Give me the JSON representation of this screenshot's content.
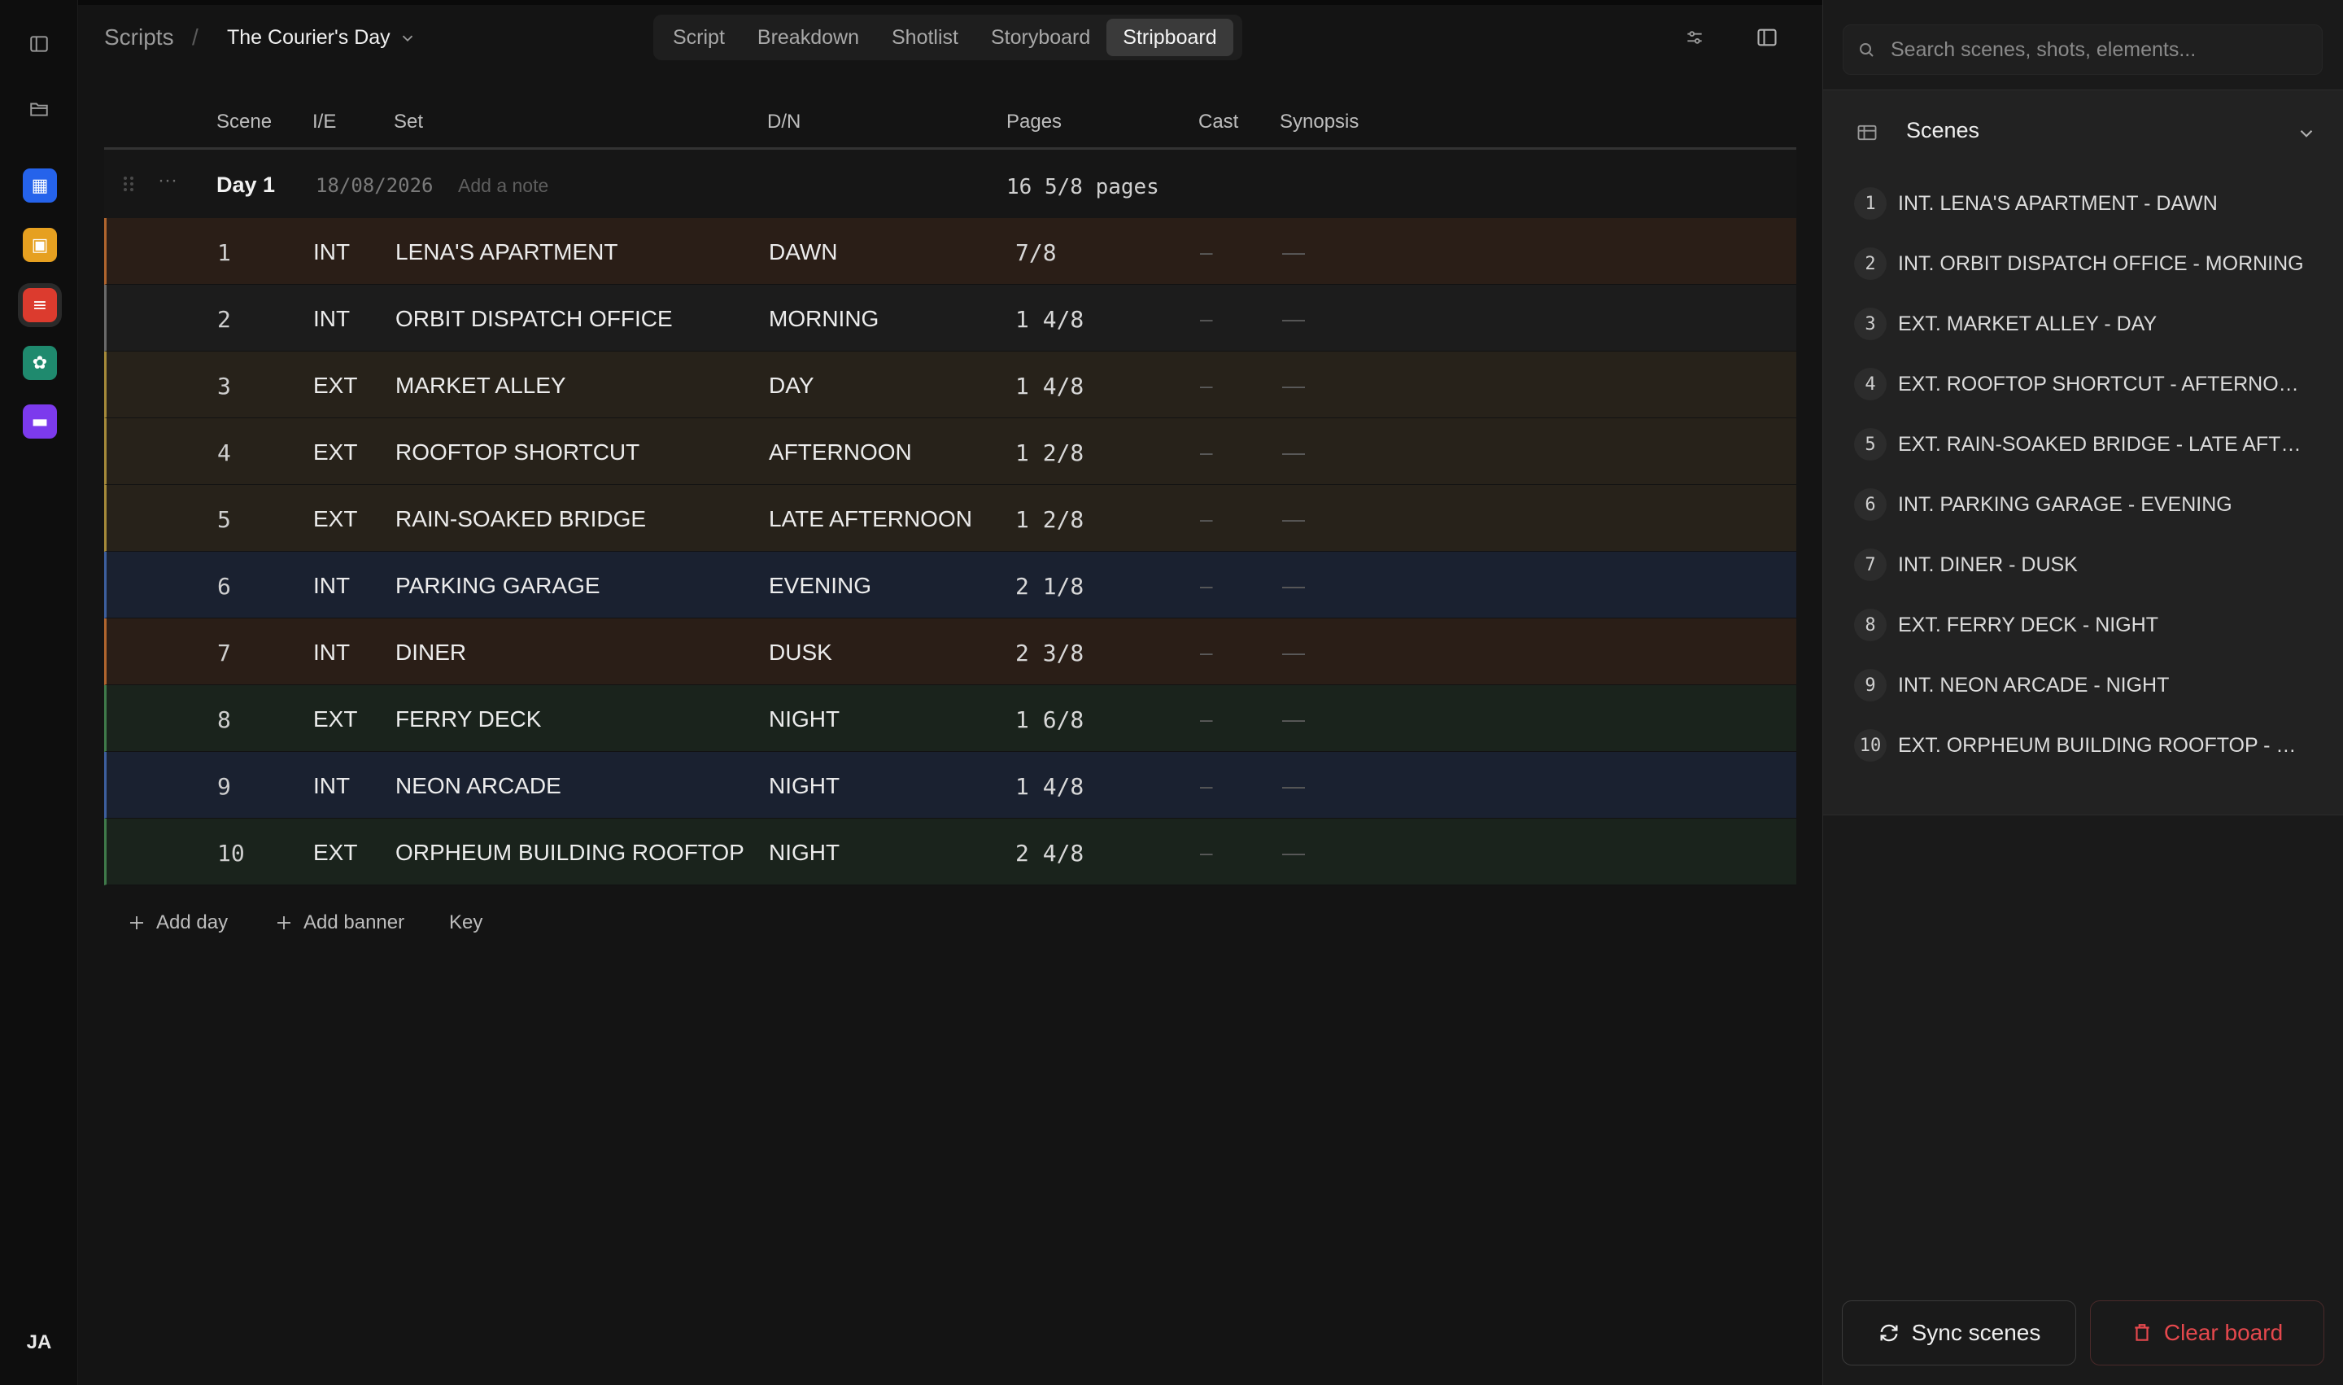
{
  "breadcrumb": {
    "root": "Scripts",
    "separator": "/",
    "document": "The Courier's Day"
  },
  "tabs": [
    {
      "label": "Script",
      "active": false
    },
    {
      "label": "Breakdown",
      "active": false
    },
    {
      "label": "Shotlist",
      "active": false
    },
    {
      "label": "Storyboard",
      "active": false
    },
    {
      "label": "Stripboard",
      "active": true
    }
  ],
  "rail": {
    "apps": [
      {
        "name": "board-app-icon",
        "color": "#2563eb"
      },
      {
        "name": "images-app-icon",
        "color": "#e6a020"
      },
      {
        "name": "script-app-icon",
        "color": "#dc3b2e",
        "active": true
      },
      {
        "name": "elements-app-icon",
        "color": "#1f8a6e"
      },
      {
        "name": "files-app-icon",
        "color": "#7c3aed"
      }
    ],
    "avatar": "JA"
  },
  "table": {
    "headers": {
      "scene": "Scene",
      "ie": "I/E",
      "set": "Set",
      "dn": "D/N",
      "pages": "Pages",
      "cast": "Cast",
      "synopsis": "Synopsis"
    },
    "day": {
      "title": "Day 1",
      "date": "18/08/2026",
      "note_placeholder": "Add a note",
      "pages": "16 5/8 pages"
    },
    "rows": [
      {
        "scene": "1",
        "ie": "INT",
        "set": "LENA'S APARTMENT",
        "dn": "DAWN",
        "pages": "7/8",
        "cast": "–",
        "synopsis": "—",
        "bg": "#2a1e17",
        "accent": "#b0652e"
      },
      {
        "scene": "2",
        "ie": "INT",
        "set": "ORBIT DISPATCH OFFICE",
        "dn": "MORNING",
        "pages": "1 4/8",
        "cast": "–",
        "synopsis": "—",
        "bg": "#1c1c1c",
        "accent": "#6a6a6a"
      },
      {
        "scene": "3",
        "ie": "EXT",
        "set": "MARKET ALLEY",
        "dn": "DAY",
        "pages": "1 4/8",
        "cast": "–",
        "synopsis": "—",
        "bg": "#27221a",
        "accent": "#a58a3a"
      },
      {
        "scene": "4",
        "ie": "EXT",
        "set": "ROOFTOP SHORTCUT",
        "dn": "AFTERNOON",
        "pages": "1 2/8",
        "cast": "–",
        "synopsis": "—",
        "bg": "#27221a",
        "accent": "#a58a3a"
      },
      {
        "scene": "5",
        "ie": "EXT",
        "set": "RAIN-SOAKED BRIDGE",
        "dn": "LATE AFTERNOON",
        "pages": "1 2/8",
        "cast": "–",
        "synopsis": "—",
        "bg": "#27221a",
        "accent": "#a58a3a"
      },
      {
        "scene": "6",
        "ie": "INT",
        "set": "PARKING GARAGE",
        "dn": "EVENING",
        "pages": "2 1/8",
        "cast": "–",
        "synopsis": "—",
        "bg": "#1a2130",
        "accent": "#3d5f9e"
      },
      {
        "scene": "7",
        "ie": "INT",
        "set": "DINER",
        "dn": "DUSK",
        "pages": "2 3/8",
        "cast": "–",
        "synopsis": "—",
        "bg": "#2a1e17",
        "accent": "#b0652e"
      },
      {
        "scene": "8",
        "ie": "EXT",
        "set": "FERRY DECK",
        "dn": "NIGHT",
        "pages": "1 6/8",
        "cast": "–",
        "synopsis": "—",
        "bg": "#1a231c",
        "accent": "#3f7a4a"
      },
      {
        "scene": "9",
        "ie": "INT",
        "set": "NEON ARCADE",
        "dn": "NIGHT",
        "pages": "1 4/8",
        "cast": "–",
        "synopsis": "—",
        "bg": "#1a2130",
        "accent": "#3d5f9e"
      },
      {
        "scene": "10",
        "ie": "EXT",
        "set": "ORPHEUM BUILDING ROOFTOP",
        "dn": "NIGHT",
        "pages": "2 4/8",
        "cast": "–",
        "synopsis": "—",
        "bg": "#1a231c",
        "accent": "#3f7a4a"
      }
    ],
    "footer": {
      "add_day": "Add day",
      "add_banner": "Add banner",
      "key": "Key"
    }
  },
  "panel": {
    "search_placeholder": "Search scenes, shots, elements...",
    "scenes_title": "Scenes",
    "scenes": [
      {
        "num": "1",
        "label": "INT. LENA'S APARTMENT - DAWN"
      },
      {
        "num": "2",
        "label": "INT. ORBIT DISPATCH OFFICE - MORNING"
      },
      {
        "num": "3",
        "label": "EXT. MARKET ALLEY - DAY"
      },
      {
        "num": "4",
        "label": "EXT. ROOFTOP SHORTCUT - AFTERNOON"
      },
      {
        "num": "5",
        "label": "EXT. RAIN-SOAKED BRIDGE - LATE AFTER..."
      },
      {
        "num": "6",
        "label": "INT. PARKING GARAGE - EVENING"
      },
      {
        "num": "7",
        "label": "INT. DINER - DUSK"
      },
      {
        "num": "8",
        "label": "EXT. FERRY DECK - NIGHT"
      },
      {
        "num": "9",
        "label": "INT. NEON ARCADE - NIGHT"
      },
      {
        "num": "10",
        "label": "EXT. ORPHEUM BUILDING ROOFTOP - NIG..."
      }
    ],
    "sync_label": "Sync scenes",
    "clear_label": "Clear board"
  }
}
